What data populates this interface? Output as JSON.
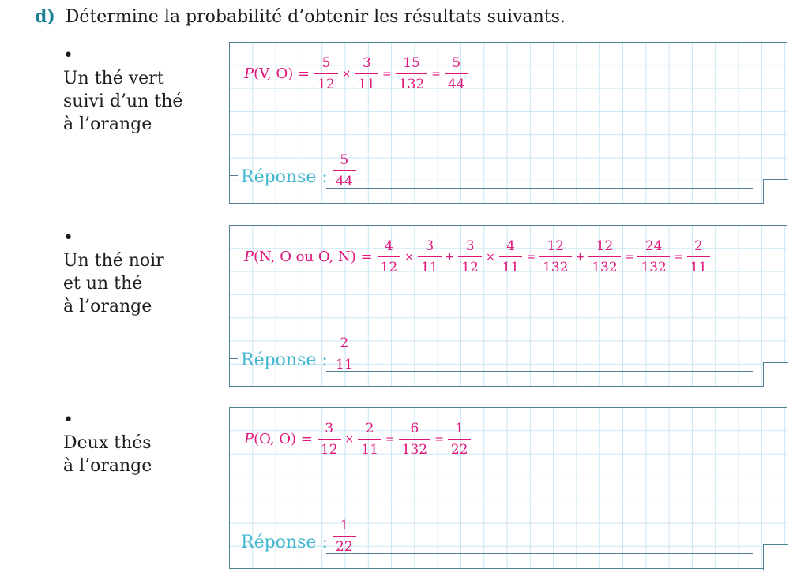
{
  "question": {
    "label": "d)",
    "text": "Détermine la probabilité d’obtenir les résultats suivants."
  },
  "bullet": "•",
  "answer_label": "Réponse :",
  "items": [
    {
      "label_lines": [
        "Un thé vert",
        "suivi d’un thé",
        "à l’orange"
      ],
      "formula_prefix_p": "P",
      "formula_prefix_rest": "(V, O) =",
      "terms": [
        {
          "num": "5",
          "den": "12"
        },
        {
          "op": "×"
        },
        {
          "num": "3",
          "den": "11"
        },
        {
          "op": "="
        },
        {
          "num": "15",
          "den": "132"
        },
        {
          "op": "="
        },
        {
          "num": "5",
          "den": "44"
        }
      ],
      "answer": {
        "num": "5",
        "den": "44"
      }
    },
    {
      "label_lines": [
        "Un thé noir",
        "et un thé",
        "à l’orange"
      ],
      "formula_prefix_p": "P",
      "formula_prefix_rest": "(N, O ou O, N) =",
      "terms": [
        {
          "num": "4",
          "den": "12"
        },
        {
          "op": "×"
        },
        {
          "num": "3",
          "den": "11"
        },
        {
          "op": "+"
        },
        {
          "num": "3",
          "den": "12"
        },
        {
          "op": "×"
        },
        {
          "num": "4",
          "den": "11"
        },
        {
          "op": "="
        },
        {
          "num": "12",
          "den": "132"
        },
        {
          "op": "+"
        },
        {
          "num": "12",
          "den": "132"
        },
        {
          "op": "="
        },
        {
          "num": "24",
          "den": "132"
        },
        {
          "op": "="
        },
        {
          "num": "2",
          "den": "11"
        }
      ],
      "answer": {
        "num": "2",
        "den": "11"
      }
    },
    {
      "label_lines": [
        "Deux thés",
        "à l’orange"
      ],
      "formula_prefix_p": "P",
      "formula_prefix_rest": "(O, O) =",
      "terms": [
        {
          "num": "3",
          "den": "12"
        },
        {
          "op": "×"
        },
        {
          "num": "2",
          "den": "11"
        },
        {
          "op": "="
        },
        {
          "num": "6",
          "den": "132"
        },
        {
          "op": "="
        },
        {
          "num": "1",
          "den": "22"
        }
      ],
      "answer": {
        "num": "1",
        "den": "22"
      }
    }
  ]
}
